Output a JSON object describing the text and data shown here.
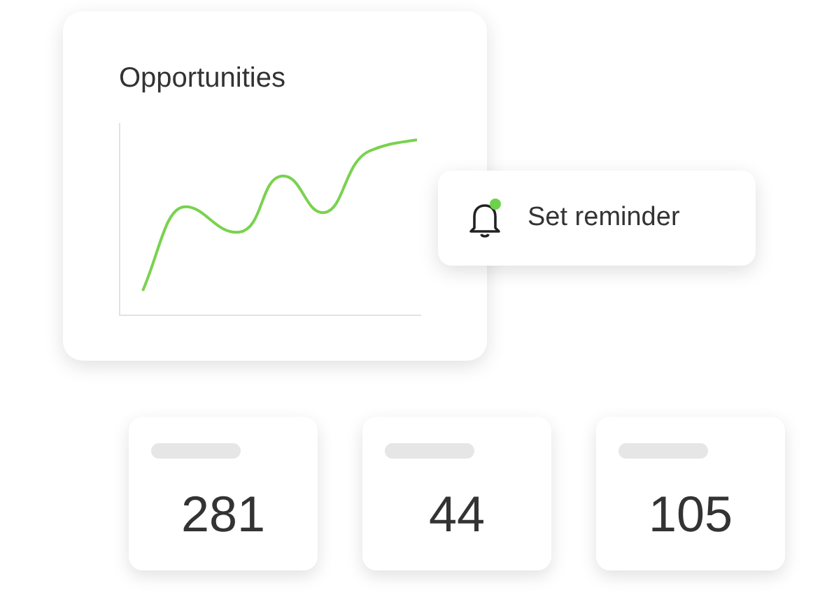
{
  "opportunities_card": {
    "title": "Opportunities"
  },
  "reminder": {
    "label": "Set reminder",
    "notification_dot": true
  },
  "stats": [
    {
      "value": "281"
    },
    {
      "value": "44"
    },
    {
      "value": "105"
    }
  ]
}
